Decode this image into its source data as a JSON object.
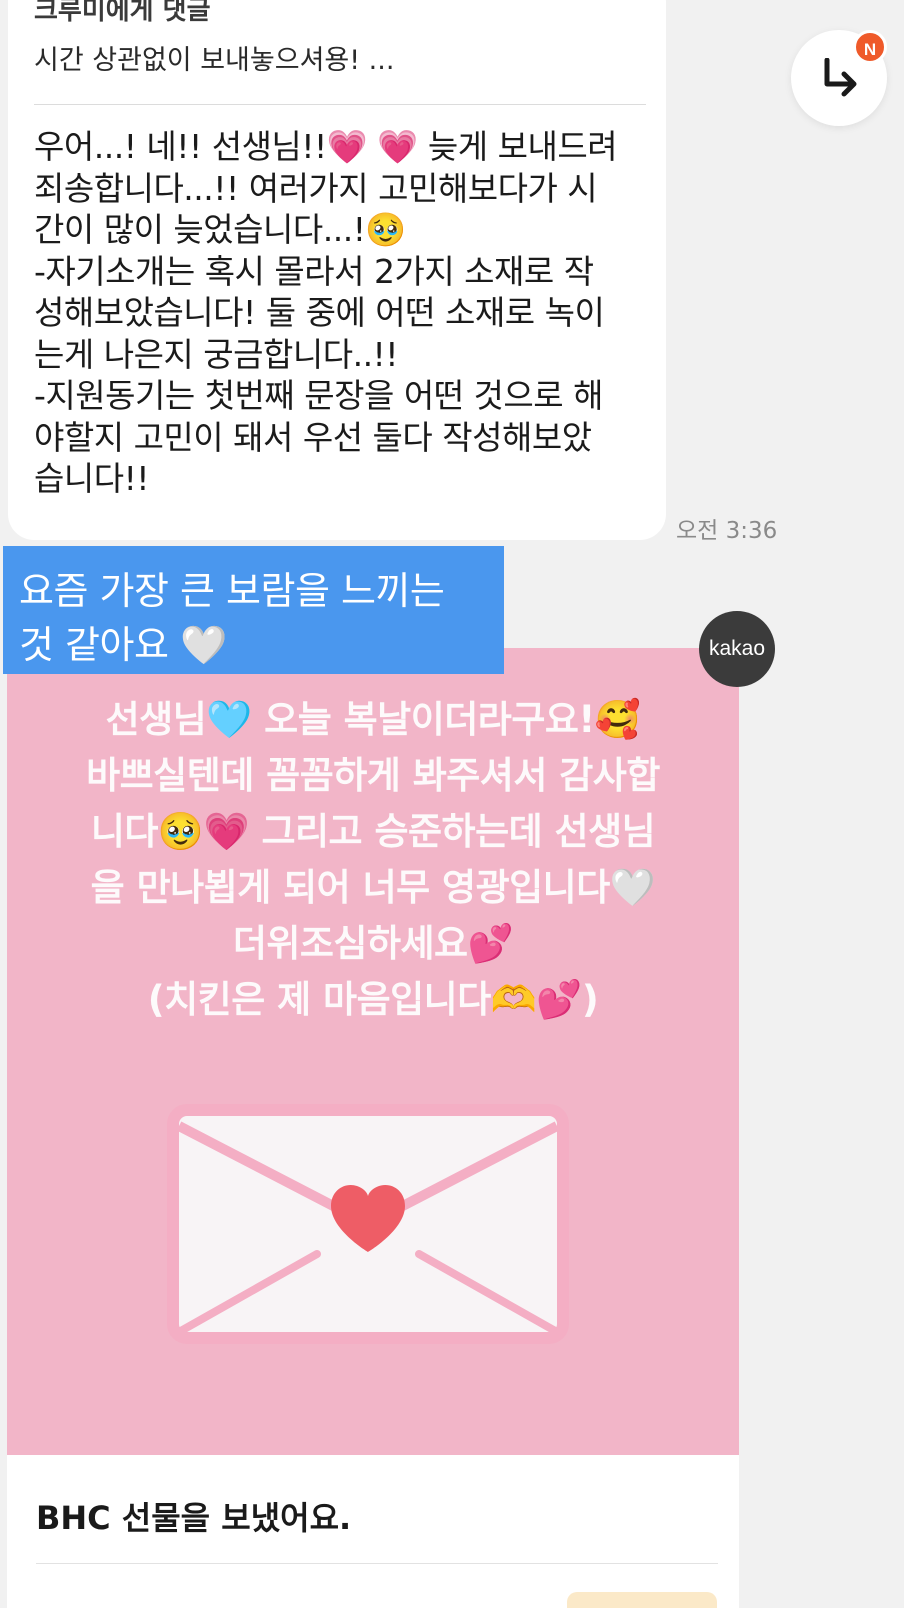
{
  "reply": {
    "header": "크루미에게 댓글",
    "preview": "시간 상관없이 보내놓으셔용! ..."
  },
  "message": {
    "lines": [
      "우어...! 네!! 선생님!!💗 💗 늦게 보내드려",
      "죄송합니다...!! 여러가지 고민해보다가 시",
      "간이 많이 늦었습니다...!🥹",
      "-자기소개는 혹시 몰라서 2가지 소재로 작",
      "성해보았습니다! 둘 중에 어떤 소재로 녹이",
      "는게 나은지 궁금합니다..!!",
      "-지원동기는 첫번째 문장을 어떤 것으로 해",
      "야할지 고민이 돼서 우선 둘다 작성해보았",
      "습니다!!"
    ],
    "time": "오전 3:36"
  },
  "fab": {
    "icon": "reply-arrow-icon",
    "badge": "N"
  },
  "caption": {
    "line1": "요즘 가장 큰 보람을 느끼는",
    "line2": "것 같아요 🤍"
  },
  "avatar": {
    "label": "kakao"
  },
  "gift": {
    "lines": [
      "선생님🩵 오늘 복날이더라구요!🥰",
      "바쁘실텐데 꼼꼼하게 봐주셔서 감사합",
      "니다🥹💗 그리고 승준하는데 선생님",
      "을 만나뵙게 되어 너무 영광입니다🤍",
      "더위조심하세요💕",
      "(치킨은 제 마음입니다🫶💕)"
    ],
    "title": "BHC 선물을 보냈어요."
  },
  "colors": {
    "background": "#f1f1f1",
    "caption_bg": "#4a97ee",
    "gift_pink": "#f2b5c8",
    "badge": "#ef5a2a"
  }
}
